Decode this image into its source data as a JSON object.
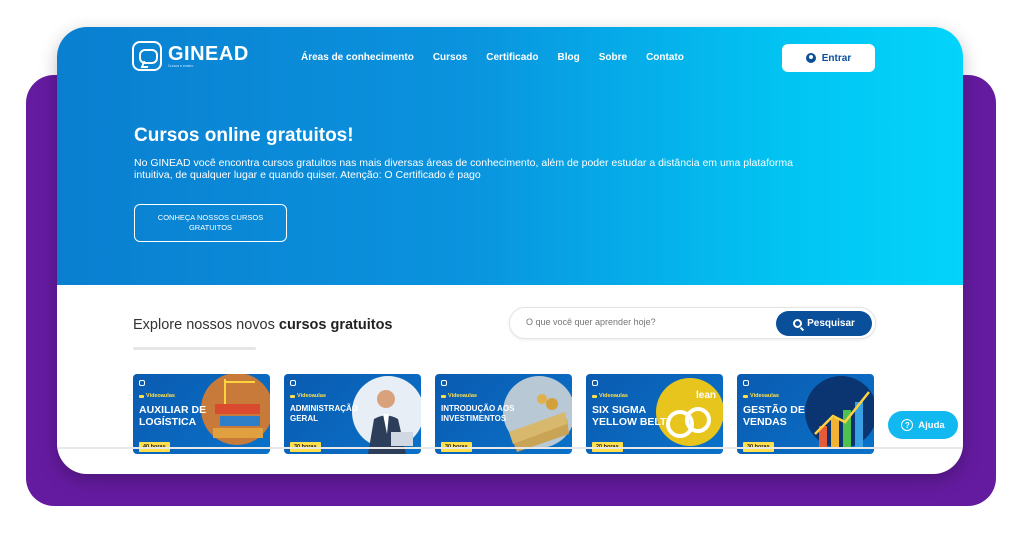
{
  "header": {
    "logo_name": "GINEAD",
    "logo_tagline": "Cursos e ensino",
    "nav": [
      "Áreas de conhecimento",
      "Cursos",
      "Certificado",
      "Blog",
      "Sobre",
      "Contato"
    ],
    "login_label": "Entrar"
  },
  "hero": {
    "title": "Cursos online gratuitos!",
    "description": "No GINEAD você encontra cursos gratuitos nas mais diversas áreas de conhecimento, além de poder estudar a distância em uma plataforma intuitiva, de qualquer lugar e quando quiser. Atenção: O Certificado é pago",
    "cta": "CONHEÇA NOSSOS CURSOS GRATUITOS"
  },
  "explore": {
    "prefix": "Explore nossos novos",
    "highlight": "cursos gratuitos"
  },
  "search": {
    "placeholder": "O que você quer aprender hoje?",
    "button": "Pesquisar"
  },
  "courses": [
    {
      "badge": "Videoaulas",
      "title": "AUXILIAR DE LOGÍSTICA",
      "hours": "40 horas"
    },
    {
      "badge": "Videoaulas",
      "title": "ADMINISTRAÇÃO GERAL",
      "hours": "30 horas"
    },
    {
      "badge": "Videoaulas",
      "title": "INTRODUÇÃO AOS INVESTIMENTOS",
      "hours": "30 horas"
    },
    {
      "badge": "Videoaulas",
      "title": "SIX SIGMA YELLOW BELT",
      "hours": "20 horas"
    },
    {
      "badge": "Videoaulas",
      "title": "GESTÃO DE VENDAS",
      "hours": "30 horas"
    }
  ],
  "help": {
    "label": "Ajuda"
  },
  "colors": {
    "accent": "#0a4f9a",
    "hero_start": "#0a7fd0",
    "hero_end": "#03d4fb",
    "frame": "#651ba0",
    "badge": "#ffe04a"
  }
}
